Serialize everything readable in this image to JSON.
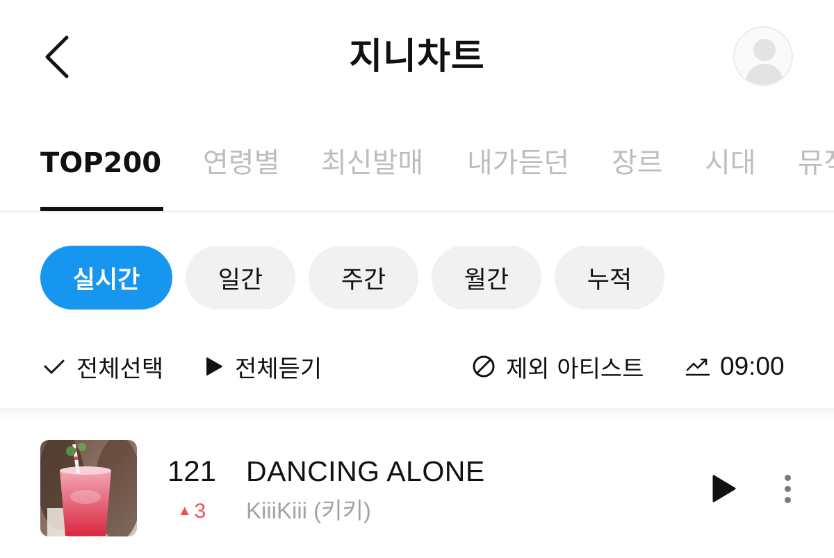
{
  "header": {
    "title": "지니차트",
    "back_icon": "chevron-left-icon",
    "avatar_icon": "user-avatar-icon"
  },
  "tabs": [
    {
      "label": "TOP200",
      "active": true
    },
    {
      "label": "연령별",
      "active": false
    },
    {
      "label": "최신발매",
      "active": false
    },
    {
      "label": "내가듣던",
      "active": false
    },
    {
      "label": "장르",
      "active": false
    },
    {
      "label": "시대",
      "active": false
    },
    {
      "label": "뮤직",
      "active": false
    }
  ],
  "periods": [
    {
      "label": "실시간",
      "active": true
    },
    {
      "label": "일간",
      "active": false
    },
    {
      "label": "주간",
      "active": false
    },
    {
      "label": "월간",
      "active": false
    },
    {
      "label": "누적",
      "active": false
    }
  ],
  "actions": {
    "select_all": "전체선택",
    "play_all": "전체듣기",
    "exclude_artist": "제외 아티스트",
    "chart_time": "09:00"
  },
  "songs": [
    {
      "rank": "121",
      "rank_change": "3",
      "rank_direction": "up",
      "title": "DANCING ALONE",
      "artist": "KiiiKiii (키키)"
    }
  ],
  "colors": {
    "accent": "#1796f0",
    "rank_up": "#ee5050",
    "inactive_tab": "#bdbdbd",
    "pill_bg": "#f1f1f1"
  }
}
